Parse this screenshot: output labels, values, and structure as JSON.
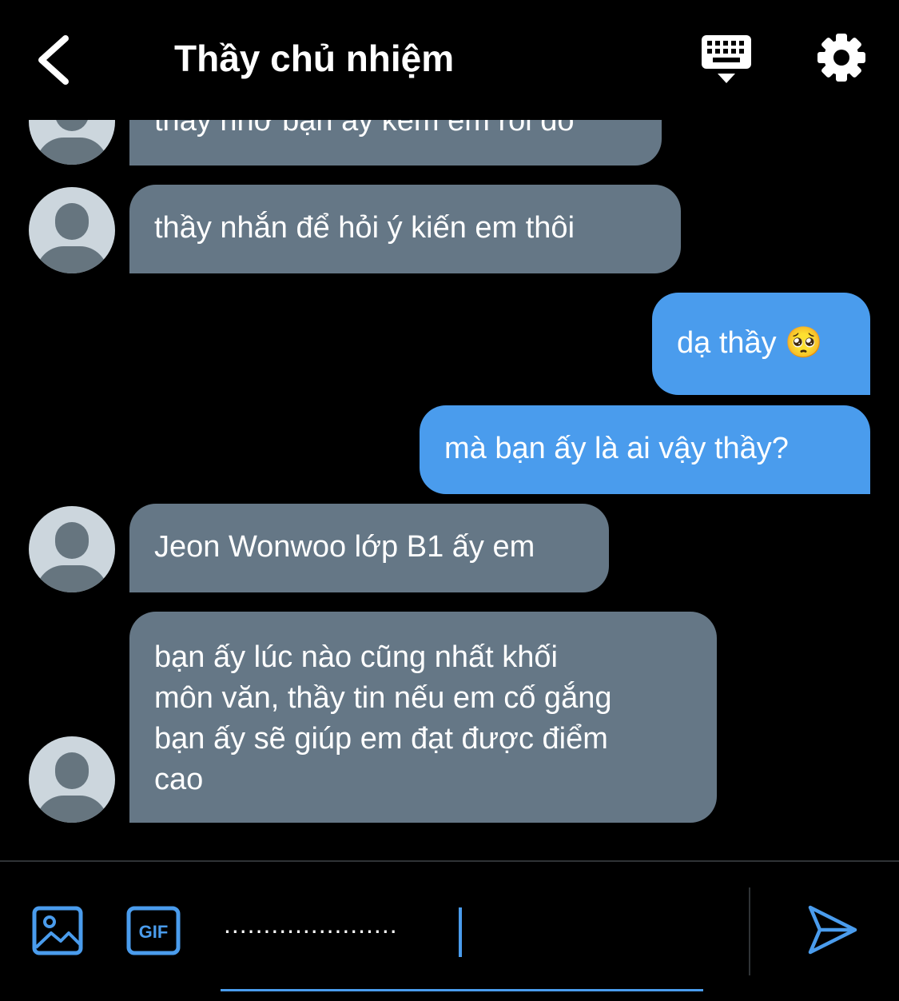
{
  "header": {
    "title": "Thầy chủ nhiệm",
    "back_icon": "chevron-left-icon",
    "keyboard_icon": "keyboard-icon",
    "settings_icon": "gear-icon"
  },
  "messages": [
    {
      "from": "them",
      "text": "thầy nhờ bạn ấy kèm em rồi đó"
    },
    {
      "from": "them",
      "text": "thầy nhắn để hỏi ý kiến em thôi"
    },
    {
      "from": "me",
      "text": "dạ thầy 🥺"
    },
    {
      "from": "me",
      "text": "mà bạn ấy là ai vậy thầy?"
    },
    {
      "from": "them",
      "text": "Jeon Wonwoo lớp B1 ấy em"
    },
    {
      "from": "them",
      "text": "bạn ấy lúc nào cũng nhất khối\nmôn văn, thầy tin nếu em cố gắng\nbạn ấy sẽ giúp em đạt được điểm\ncao"
    }
  ],
  "composer": {
    "input_value": "......................",
    "image_icon": "image-icon",
    "gif_label": "GIF",
    "send_icon": "send-icon"
  },
  "colors": {
    "background": "#000000",
    "incoming_bubble": "#657786",
    "outgoing_bubble": "#4a9ced",
    "accent": "#4a9ced",
    "avatar_bg": "#ccd6dd",
    "avatar_fg": "#66757f"
  }
}
